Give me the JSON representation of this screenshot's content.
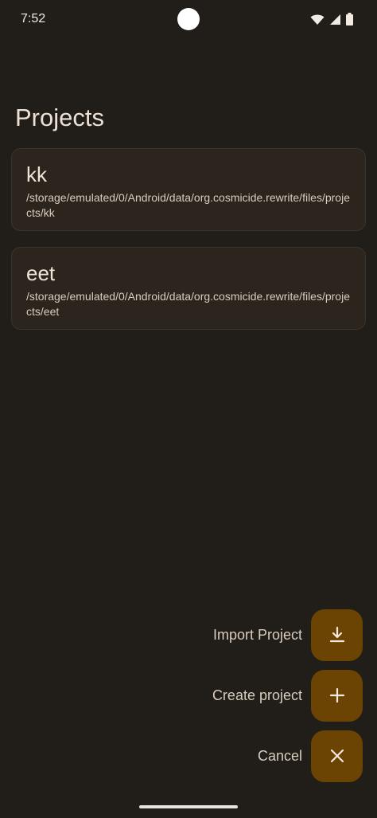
{
  "status_bar": {
    "time": "7:52",
    "icons": [
      "wifi-icon",
      "cell-signal-icon",
      "battery-icon"
    ]
  },
  "page": {
    "title": "Projects"
  },
  "projects": [
    {
      "name": "kk",
      "path": "/storage/emulated/0/Android/data/org.cosmicide.rewrite/files/projects/kk"
    },
    {
      "name": "eet",
      "path": "/storage/emulated/0/Android/data/org.cosmicide.rewrite/files/projects/eet"
    }
  ],
  "fab_menu": {
    "import_label": "Import Project",
    "import_icon": "download-icon",
    "create_label": "Create project",
    "create_icon": "plus-icon",
    "cancel_label": "Cancel",
    "cancel_icon": "close-icon"
  },
  "colors": {
    "background": "#211e1a",
    "card": "#2c251e",
    "fab": "#6b4303",
    "text": "#ece1d4"
  }
}
